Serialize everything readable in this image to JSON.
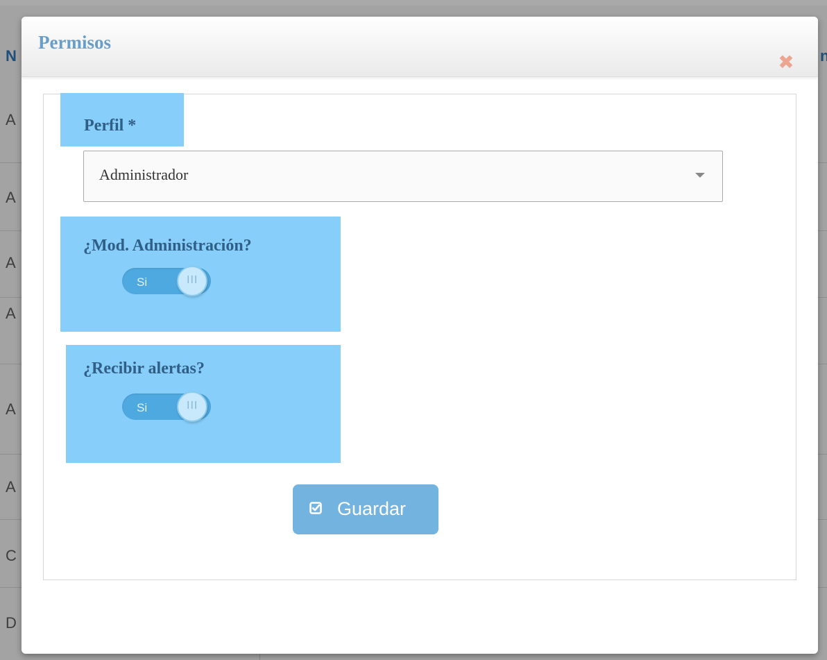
{
  "background": {
    "left_column": [
      "N",
      "A",
      "A",
      "A",
      "A",
      "A",
      "A",
      "C",
      "D"
    ],
    "right_column": [
      "n"
    ]
  },
  "modal": {
    "title": "Permisos",
    "close_icon": "close-icon",
    "profile": {
      "label": "Perfil *",
      "selected": "Administrador"
    },
    "admin_module": {
      "label": "¿Mod. Administración?",
      "toggle_text": "Si",
      "toggle_knob": "III"
    },
    "alerts": {
      "label": "¿Recibir alertas?",
      "toggle_text": "Si",
      "toggle_knob": "III"
    },
    "save_button": {
      "label": "Guardar",
      "icon": "check-square-icon"
    }
  },
  "colors": {
    "title": "#6a9ec7",
    "label": "#2f5f86",
    "highlight": "#87cefa",
    "toggle_track": "#4ea9e0",
    "button": "#73b3e0",
    "close": "#eda58f"
  }
}
